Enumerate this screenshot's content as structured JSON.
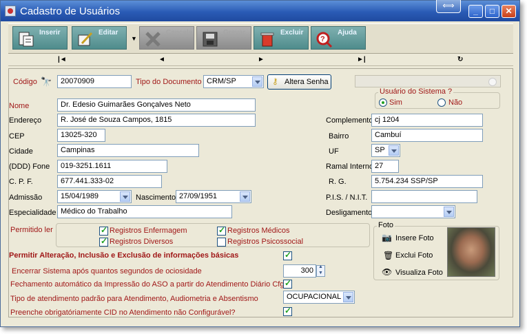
{
  "window": {
    "title": "Cadastro de Usuários"
  },
  "toolbar": {
    "insert": "Inserir",
    "edit": "Editar",
    "cancel": "Cancela",
    "save": "Gravar",
    "delete": "Excluir",
    "help": "Ajuda"
  },
  "nav": {
    "first": "|◄",
    "prev": "◄",
    "next": "►",
    "last": "►|",
    "refresh": "↻"
  },
  "form": {
    "codigo_label": "Código",
    "codigo": "20070909",
    "tipo_doc_label": "Tipo do Documento",
    "tipo_doc": "CRM/SP",
    "altera_senha": "Altera Senha",
    "usuario_sistema_label": "Usuário do Sistema  ?",
    "sim": "Sim",
    "nao": "Não",
    "nome_label": "Nome",
    "nome": "Dr. Edesio Guimarães Gonçalves Neto",
    "endereco_label": "Endereço",
    "endereco": "R. José de Souza Campos, 1815",
    "complemento_label": "Complemento",
    "complemento": "cj 1204",
    "cep_label": "CEP",
    "cep": "13025-320",
    "bairro_label": "Bairro",
    "bairro": "Cambuí",
    "cidade_label": "Cidade",
    "cidade": "Campinas",
    "uf_label": "UF",
    "uf": "SP",
    "fone_label": "(DDD) Fone",
    "fone": "019-3251.1611",
    "ramal_label": "Ramal Interno",
    "ramal": "27",
    "cpf_label": "C. P. F.",
    "cpf": "677.441.333-02",
    "rg_label": "R. G.",
    "rg": "5.754.234 SSP/SP",
    "admissao_label": "Admissão",
    "admissao": "15/04/1989",
    "nascimento_label": "Nascimento",
    "nascimento": "27/09/1951",
    "pis_label": "P.I.S. / N.I.T.",
    "pis": "",
    "especialidade_label": "Especialidade",
    "especialidade": "Médico do Trabalho",
    "desligamento_label": "Desligamento",
    "desligamento": "",
    "permitido_ler_label": "Permitido ler",
    "perm_enfermagem": "Registros Enfermagem",
    "perm_medicos": "Registros Médicos",
    "perm_diversos": "Registros Diversos",
    "perm_psicossocial": "Registros Psicossocial",
    "foto_label": "Foto",
    "insere_foto": "Insere Foto",
    "exclui_foto": "Exclui Foto",
    "visualiza_foto": "Visualiza Foto",
    "permitir_label": "Permitir Alteração, Inclusão e Exclusão de informações básicas",
    "encerrar_label": "Encerrar Sistema após quantos segundos de ociosidade",
    "encerrar_value": "300",
    "fechamento_label": "Fechamento automático da Impressão do ASO a partir do Atendimento Diário Cfg?",
    "tipo_atend_label": "Tipo de atendimento padrão para Atendimento, Audiometria e Absentismo",
    "tipo_atend_value": "OCUPACIONAL",
    "cid_label": "Preenche obrigatóriamente CID no Atendimento não Configurável?"
  },
  "colors": {
    "required_label": "#a01818",
    "titlebar": "#2a5bb5"
  }
}
